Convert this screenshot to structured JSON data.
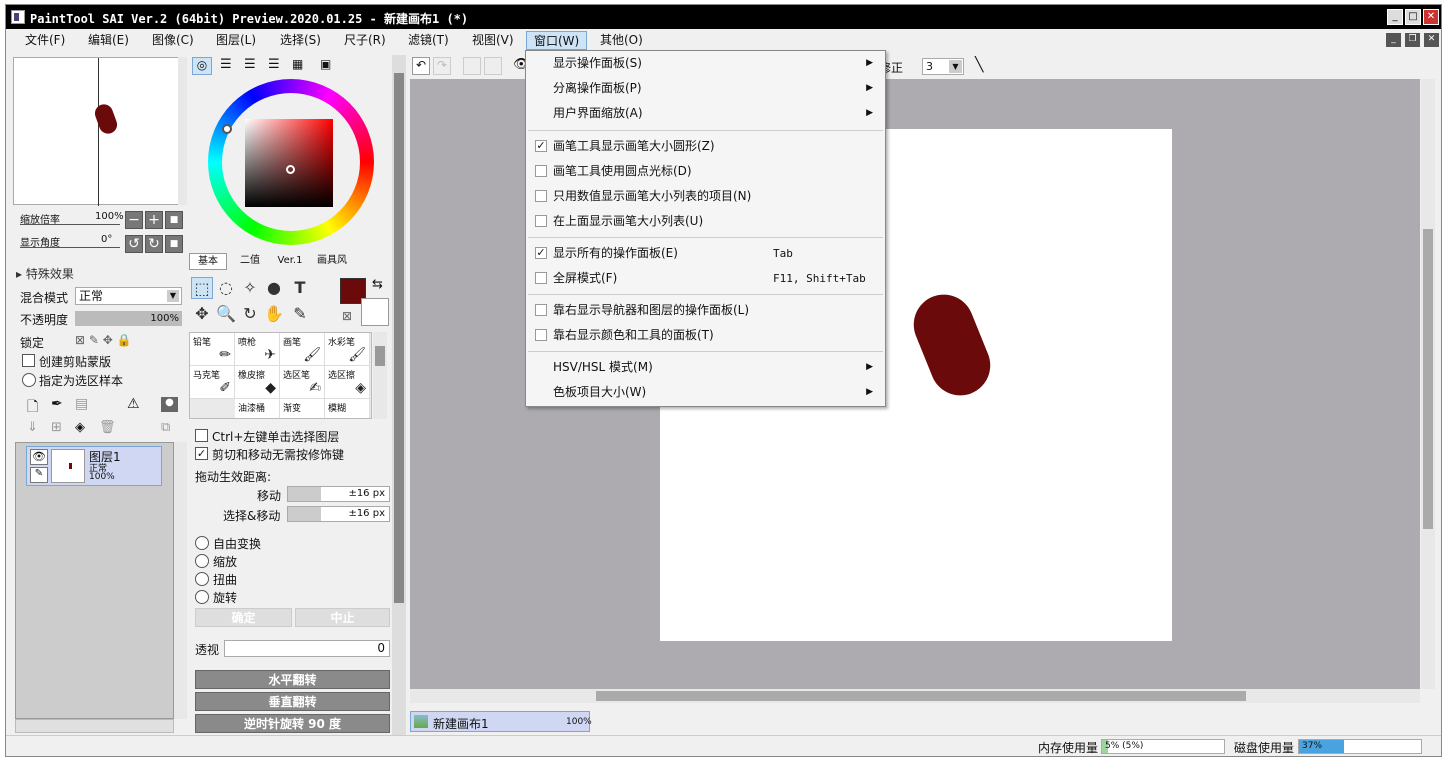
{
  "titlebar": {
    "title": "PaintTool SAI Ver.2 (64bit) Preview.2020.01.25 - 新建画布1 (*)"
  },
  "menubar": {
    "items": [
      "文件(F)",
      "编辑(E)",
      "图像(C)",
      "图层(L)",
      "选择(S)",
      "尺子(R)",
      "滤镜(T)",
      "视图(V)",
      "窗口(W)",
      "其他(O)"
    ]
  },
  "navigator": {
    "zoom_label": "缩放倍率",
    "zoom_value": "100%",
    "angle_label": "显示角度",
    "angle_value": "0°"
  },
  "layer_panel": {
    "effects_label": "特殊效果",
    "blend_label": "混合模式",
    "blend_value": "正常",
    "opacity_label": "不透明度",
    "opacity_value": "100%",
    "lock_label": "锁定",
    "clip_label": "创建剪贴蒙版",
    "select_src_label": "指定为选区样本",
    "layer_name": "图层1",
    "layer_mode": "正常",
    "layer_opacity": "100%"
  },
  "color_panel": {
    "tabs": [
      "基本",
      "二值",
      "Ver.1",
      "画具风"
    ]
  },
  "brushes": [
    {
      "name": "铅笔",
      "icon": "pencil-icon"
    },
    {
      "name": "喷枪",
      "icon": "airbrush-icon"
    },
    {
      "name": "画笔",
      "icon": "brush-icon"
    },
    {
      "name": "水彩笔",
      "icon": "watercolor-icon"
    },
    {
      "name": "马克笔",
      "icon": "marker-icon"
    },
    {
      "name": "橡皮擦",
      "icon": "eraser-icon"
    },
    {
      "name": "选区笔",
      "icon": "selpen-icon"
    },
    {
      "name": "选区擦",
      "icon": "selerase-icon"
    },
    {
      "name": "油漆桶",
      "icon": "bucket-icon"
    },
    {
      "name": "渐变",
      "icon": "gradient-icon"
    },
    {
      "name": "模糊",
      "icon": "blur-icon"
    }
  ],
  "tool_options": {
    "ctrl_label": "Ctrl+左键单击选择图层",
    "cut_label": "剪切和移动无需按修饰键",
    "drag_label": "拖动生效距离:",
    "move_label": "移动",
    "move_value": "±16 px",
    "selmove_label": "选择&移动",
    "selmove_value": "±16 px",
    "transforms": [
      "自由变换",
      "缩放",
      "扭曲",
      "旋转"
    ],
    "ok": "确定",
    "cancel": "中止",
    "persp_label": "透视",
    "persp_value": "0",
    "flip_h": "水平翻转",
    "flip_v": "垂直翻转",
    "rotate": "逆时针旋转 90 度"
  },
  "canvas_toolbar": {
    "stab_label": "修正",
    "stab_value": "3"
  },
  "canvas_tab": {
    "name": "新建画布1",
    "zoom": "100%"
  },
  "status": {
    "mem_label": "内存使用量",
    "mem_value": "5% (5%)",
    "disk_label": "磁盘使用量",
    "disk_value": "37%",
    "mem_fraction": 0.05,
    "disk_fraction": 0.37
  },
  "window_menu": {
    "items": [
      {
        "label": "显示操作面板(S)",
        "submenu": true
      },
      {
        "label": "分离操作面板(P)",
        "submenu": true
      },
      {
        "label": "用户界面缩放(A)",
        "submenu": true
      },
      {
        "label": "画笔工具显示画笔大小圆形(Z)",
        "checked": true
      },
      {
        "label": "画笔工具使用圆点光标(D)",
        "checked": false
      },
      {
        "label": "只用数值显示画笔大小列表的项目(N)",
        "checked": false
      },
      {
        "label": "在上面显示画笔大小列表(U)",
        "checked": false
      },
      {
        "label": "显示所有的操作面板(E)",
        "checked": true,
        "shortcut": "Tab"
      },
      {
        "label": "全屏模式(F)",
        "checked": false,
        "shortcut": "F11, Shift+Tab"
      },
      {
        "label": "靠右显示导航器和图层的操作面板(L)",
        "checked": false
      },
      {
        "label": "靠右显示颜色和工具的面板(T)",
        "checked": false
      },
      {
        "label": "HSV/HSL 模式(M)",
        "submenu": true
      },
      {
        "label": "色板项目大小(W)",
        "submenu": true
      }
    ]
  },
  "colors": {
    "foreground": "#6b0a0a",
    "accent": "#7aa7d3"
  }
}
